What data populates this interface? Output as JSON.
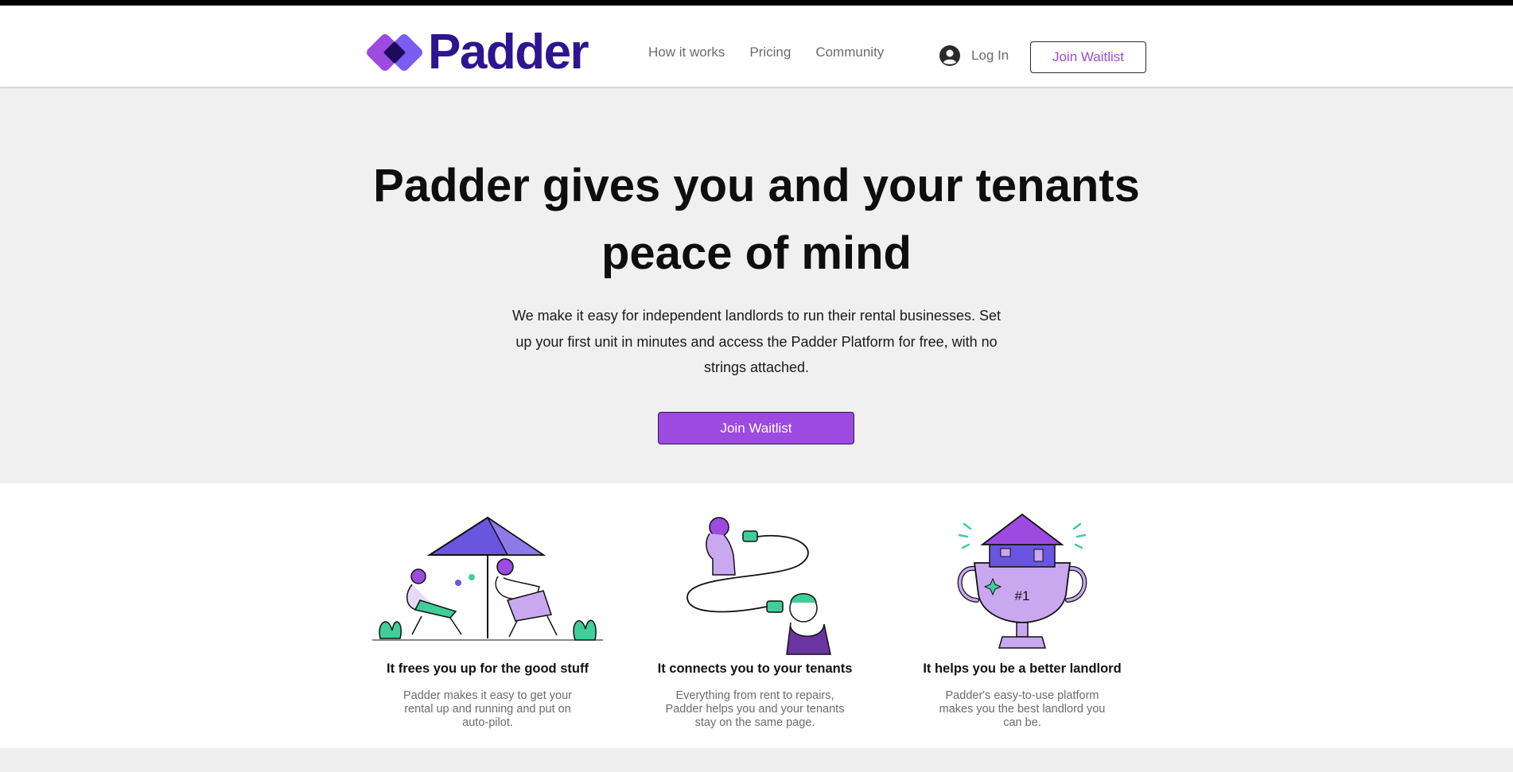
{
  "header": {
    "logo_text": "Padder",
    "nav": [
      {
        "label": "How it works"
      },
      {
        "label": "Pricing"
      },
      {
        "label": "Community"
      }
    ],
    "login_label": "Log In",
    "cta_label": "Join Waitlist"
  },
  "hero": {
    "headline": "Padder gives you and your tenants peace of mind",
    "body": "We make it easy for independent landlords to run their rental businesses. Set up your first unit in minutes and access the Padder Platform for free, with no strings attached.",
    "cta_label": "Join Waitlist"
  },
  "features": [
    {
      "title": "It frees you up for the good stuff",
      "text": "Padder makes it easy to get your rental up and running and put on auto-pilot.",
      "icon": "friends-relaxing-illustration"
    },
    {
      "title": "It connects you to your tenants",
      "text": "Everything from rent to repairs, Padder helps you and your tenants stay on the same page.",
      "icon": "tin-can-phone-illustration"
    },
    {
      "title": "It helps you be a better landlord",
      "text": "Padder's easy-to-use platform makes you the best landlord you can be.",
      "icon": "house-trophy-illustration",
      "trophy_label": "#1"
    }
  ],
  "colors": {
    "brand_navy": "#2d1591",
    "brand_purple": "#9c4ae0",
    "logo_light_purple": "#7b5cf0",
    "hero_bg": "#f0f0f0",
    "accent_green": "#3fcf9a"
  }
}
